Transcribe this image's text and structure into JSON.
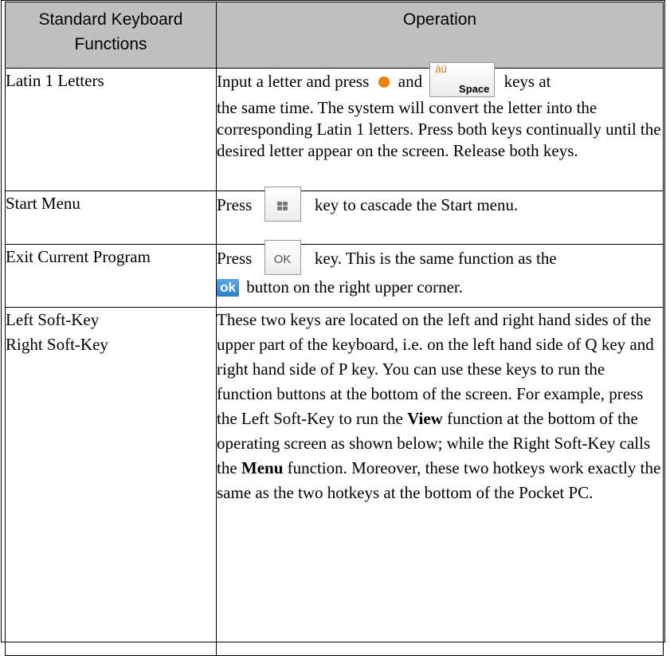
{
  "table": {
    "header": {
      "col1_line1": "Standard Keyboard",
      "col1_line2": "Functions",
      "col2": "Operation"
    },
    "rows": [
      {
        "name": "Latin 1 Letters",
        "d1": "Input a letter and press",
        "d2": "and",
        "key_space_top": "àü",
        "key_space_bottom": "Space",
        "d3": "keys at",
        "d4": "the same time. The system will convert the letter into the corresponding Latin 1 letters. Press both keys continually until the desired letter appear on the screen. Release both keys."
      },
      {
        "name": "Start Menu",
        "d1": "Press",
        "d2": "key to cascade the Start menu."
      },
      {
        "name": "Exit Current Program",
        "d1": "Press",
        "key_ok_label": "OK",
        "d2": "key. This is the same function as the",
        "ok_button": "ok",
        "d3": "button on the right upper corner."
      },
      {
        "name_line1": "Left Soft-Key",
        "name_line2": "Right Soft-Key",
        "d1": "These two keys are located on the left and right hand sides of the upper part of the keyboard, i.e. on the left hand side of Q key and right hand side of P key. You can use these keys to run the function buttons at the bottom of the screen. For example, press the Left Soft-Key to run the",
        "bold1": "View",
        "d2": "function at the bottom of the operating screen as shown below; while the Right Soft-Key calls the",
        "bold2": "Menu",
        "d3": "function. Moreover, these two hotkeys work exactly the same as the two hotkeys at the bottom of the Pocket PC."
      }
    ]
  },
  "colors": {
    "header_bg": "#c0c0c0",
    "orange_dot": "#f08000",
    "ok_button": "#2a7cc8"
  }
}
